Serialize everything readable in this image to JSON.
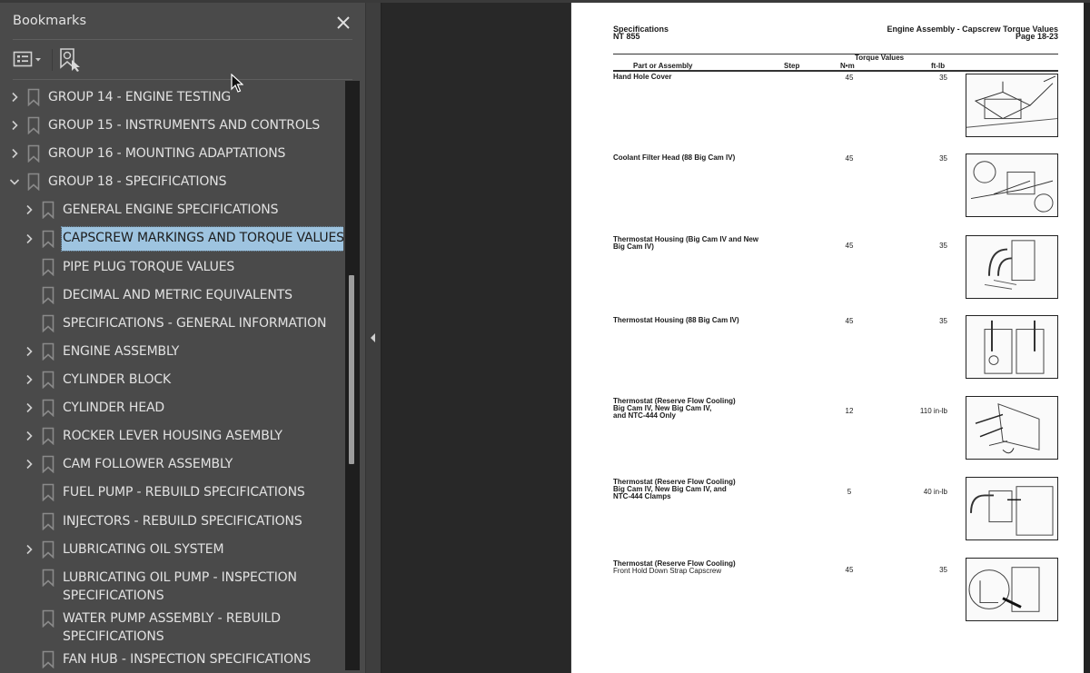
{
  "bookmarks_panel": {
    "title": "Bookmarks",
    "close_icon": "close-icon",
    "toolbar": {
      "options_icon": "list-options-icon",
      "find_icon": "find-current-bookmark-icon"
    },
    "items": [
      {
        "label": "GROUP 14 - ENGINE TESTING",
        "level": 0,
        "expandable": true,
        "expanded": false
      },
      {
        "label": "GROUP 15 - INSTRUMENTS AND CONTROLS",
        "level": 0,
        "expandable": true,
        "expanded": false
      },
      {
        "label": "GROUP 16 - MOUNTING ADAPTATIONS",
        "level": 0,
        "expandable": true,
        "expanded": false
      },
      {
        "label": "GROUP 18 - SPECIFICATIONS",
        "level": 0,
        "expandable": true,
        "expanded": true
      },
      {
        "label": "GENERAL ENGINE SPECIFICATIONS",
        "level": 1,
        "expandable": true,
        "expanded": false
      },
      {
        "label": "CAPSCREW MARKINGS AND TORQUE VALUES",
        "level": 1,
        "expandable": true,
        "expanded": false,
        "selected": true
      },
      {
        "label": "PIPE PLUG TORQUE VALUES",
        "level": 1,
        "expandable": false
      },
      {
        "label": "DECIMAL AND METRIC EQUIVALENTS",
        "level": 1,
        "expandable": false
      },
      {
        "label": "SPECIFICATIONS - GENERAL INFORMATION",
        "level": 1,
        "expandable": false
      },
      {
        "label": "ENGINE ASSEMBLY",
        "level": 1,
        "expandable": true,
        "expanded": false
      },
      {
        "label": "CYLINDER BLOCK",
        "level": 1,
        "expandable": true,
        "expanded": false
      },
      {
        "label": "CYLINDER HEAD",
        "level": 1,
        "expandable": true,
        "expanded": false
      },
      {
        "label": "ROCKER LEVER HOUSING ASEMBLY",
        "level": 1,
        "expandable": true,
        "expanded": false
      },
      {
        "label": "CAM FOLLOWER ASSEMBLY",
        "level": 1,
        "expandable": true,
        "expanded": false
      },
      {
        "label": "FUEL PUMP - REBUILD SPECIFICATIONS",
        "level": 1,
        "expandable": false
      },
      {
        "label": "INJECTORS - REBUILD SPECIFICATIONS",
        "level": 1,
        "expandable": false
      },
      {
        "label": "LUBRICATING OIL SYSTEM",
        "level": 1,
        "expandable": true,
        "expanded": false
      },
      {
        "label": "LUBRICATING OIL PUMP - INSPECTION SPECIFICATIONS",
        "level": 1,
        "expandable": false
      },
      {
        "label": "WATER PUMP ASSEMBLY - REBUILD SPECIFICATIONS",
        "level": 1,
        "expandable": false
      },
      {
        "label": "FAN HUB - INSPECTION SPECIFICATIONS",
        "level": 1,
        "expandable": false
      }
    ]
  },
  "document": {
    "header_left": [
      "Specifications",
      "NT 855"
    ],
    "header_right": [
      "Engine Assembly - Capscrew Torque Values",
      "Page 18-23"
    ],
    "table": {
      "group_header": "Torque Values",
      "columns": [
        "Part or Assembly",
        "Step",
        "N•m",
        "ft-lb"
      ],
      "rows": [
        {
          "part_bold": [
            "Hand Hole Cover"
          ],
          "part_plain": [],
          "step": "",
          "nm": "45",
          "ftlb": "35"
        },
        {
          "part_bold": [
            "Coolant Filter Head (88 Big Cam IV)"
          ],
          "part_plain": [],
          "step": "",
          "nm": "45",
          "ftlb": "35"
        },
        {
          "part_bold": [
            "Thermostat Housing (Big Cam IV and New",
            "Big Cam IV)"
          ],
          "part_plain": [],
          "step": "",
          "nm": "45",
          "ftlb": "35"
        },
        {
          "part_bold": [
            "Thermostat Housing (88 Big Cam IV)"
          ],
          "part_plain": [],
          "step": "",
          "nm": "45",
          "ftlb": "35"
        },
        {
          "part_bold": [
            "Thermostat (Reserve Flow Cooling)",
            "Big Cam IV, New Big Cam IV,",
            "and NTC-444 Only"
          ],
          "part_plain": [],
          "step": "",
          "nm": "12",
          "ftlb": "110 in-lb"
        },
        {
          "part_bold": [
            "Thermostat (Reserve Flow Cooling)",
            "Big Cam IV, New Big Cam IV, and",
            "NTC-444 Clamps"
          ],
          "part_plain": [],
          "step": "",
          "nm": "5",
          "ftlb": "40 in-lb"
        },
        {
          "part_bold": [
            "Thermostat (Reserve Flow Cooling)"
          ],
          "part_plain": [
            "Front Hold Down Strap Capscrew"
          ],
          "step": "",
          "nm": "45",
          "ftlb": "35"
        }
      ]
    },
    "figures": [
      "hand-hole-cover-illustration",
      "coolant-filter-head-illustration",
      "thermostat-housing-illustration",
      "thermostat-housing-88-illustration",
      "thermostat-reserve-flow-illustration",
      "thermostat-clamps-illustration",
      "hold-down-strap-illustration"
    ]
  },
  "colors": {
    "panel_bg": "#4a4a4a",
    "doc_bg": "#282828",
    "selection": "#9ec4e0",
    "text": "#e2e2e2"
  }
}
